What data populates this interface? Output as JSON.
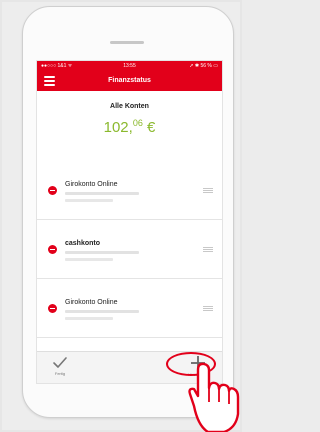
{
  "status_bar": {
    "carrier": "●●○○○ 1&1 ᯤ",
    "time": "13:55",
    "battery": "➚ ✱ 56 % ▭"
  },
  "nav": {
    "title": "Finanzstatus",
    "menu_icon": "hamburger-menu-icon"
  },
  "summary": {
    "title": "Alle Konten",
    "balance_main": "102,",
    "balance_cents": "06",
    "balance_currency": " €"
  },
  "accounts": [
    {
      "name": "Girokonto Online"
    },
    {
      "name": "cashkonto"
    },
    {
      "name": "Girokonto Online"
    }
  ],
  "toolbar": {
    "done_label": "Fertig",
    "add_label": "Hinzufügen"
  },
  "colors": {
    "brand_red": "#e2001a",
    "balance_green": "#8bb92e"
  }
}
